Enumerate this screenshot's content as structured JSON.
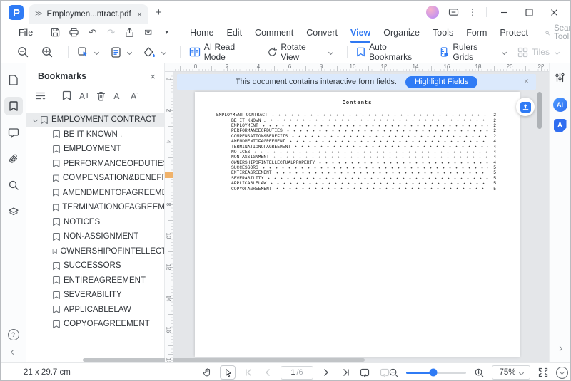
{
  "window": {
    "tab_title": "Employmen...ntract.pdf *"
  },
  "glyphs": {
    "tab_overflow": "≫",
    "kebab": "⋮",
    "plus": "+",
    "minus": "-",
    "close": "×",
    "undo": "↶",
    "redo": "↷",
    "mail": "✉",
    "dropdown_caret": "▾",
    "letter_a": "A",
    "ibeam": "I",
    "question": "?"
  },
  "menu": {
    "file": "File",
    "items": [
      {
        "label": "Home"
      },
      {
        "label": "Edit"
      },
      {
        "label": "Comment"
      },
      {
        "label": "Convert"
      },
      {
        "label": "View",
        "active": true
      },
      {
        "label": "Organize"
      },
      {
        "label": "Tools"
      },
      {
        "label": "Form"
      },
      {
        "label": "Protect"
      }
    ],
    "search_tools": "Search Tools"
  },
  "toolbar": {
    "ai_read_mode": "AI Read Mode",
    "rotate_view": "Rotate View",
    "auto_bookmarks": "Auto Bookmarks",
    "rulers_grids": "Rulers Grids",
    "tiles": "Tiles"
  },
  "bookmarks": {
    "title": "Bookmarks",
    "items": [
      {
        "label": "EMPLOYMENT CONTRACT",
        "level": 0,
        "selected": true
      },
      {
        "label": "BE IT KNOWN ,",
        "level": 1
      },
      {
        "label": "EMPLOYMENT",
        "level": 1
      },
      {
        "label": "PERFORMANCEOFDUTIES",
        "level": 1
      },
      {
        "label": "COMPENSATION&BENEFITS",
        "level": 1
      },
      {
        "label": "AMENDMENTOFAGREEMENT",
        "level": 1
      },
      {
        "label": "TERMINATIONOFAGREEMENT",
        "level": 1
      },
      {
        "label": "NOTICES",
        "level": 1
      },
      {
        "label": "NON-ASSIGNMENT",
        "level": 1
      },
      {
        "label": "OWNERSHIPOFINTELLECTUALPROPERTY",
        "level": 1
      },
      {
        "label": "SUCCESSORS",
        "level": 1
      },
      {
        "label": "ENTIREAGREEMENT",
        "level": 1
      },
      {
        "label": "SEVERABILITY",
        "level": 1
      },
      {
        "label": "APPLICABLELAW",
        "level": 1
      },
      {
        "label": "COPYOFAGREEMENT",
        "level": 1
      }
    ]
  },
  "notice": {
    "text": "This document contains interactive form fields.",
    "button": "Highlight Fields"
  },
  "document": {
    "title": "Contents",
    "toc": [
      {
        "label": "EMPLOYMENT CONTRACT",
        "page": "2",
        "indent": 0
      },
      {
        "label": "BE IT KNOWN ,",
        "page": "2",
        "indent": 1
      },
      {
        "label": "EMPLOYMENT",
        "page": "2",
        "indent": 1
      },
      {
        "label": "PERFORMANCEOFDUTIES",
        "page": "2",
        "indent": 1
      },
      {
        "label": "COMPENSATION&BENEFITS",
        "page": "2",
        "indent": 1
      },
      {
        "label": "AMENDMENTOFAGREEMENT",
        "page": "4",
        "indent": 1
      },
      {
        "label": "TERMINATIONOFAGREEMENT",
        "page": "4",
        "indent": 1
      },
      {
        "label": "NOTICES",
        "page": "4",
        "indent": 1
      },
      {
        "label": "NON-ASSIGNMENT",
        "page": "4",
        "indent": 1
      },
      {
        "label": "OWNERSHIPOFINTELLECTUALPROPERTY",
        "page": "4",
        "indent": 1
      },
      {
        "label": "SUCCESSORS",
        "page": "5",
        "indent": 1
      },
      {
        "label": "ENTIREAGREEMENT",
        "page": "5",
        "indent": 1
      },
      {
        "label": "SEVERABILITY",
        "page": "5",
        "indent": 1
      },
      {
        "label": "APPLICABLELAW",
        "page": "5",
        "indent": 1
      },
      {
        "label": "COPYOFAGREEMENT",
        "page": "5",
        "indent": 1
      }
    ],
    "ruler_h": [
      "0",
      "2",
      "4",
      "6",
      "8",
      "10",
      "12",
      "14",
      "16",
      "18",
      "20",
      "22"
    ],
    "ruler_v": [
      "0",
      "2",
      "4",
      "6",
      "8",
      "10",
      "12",
      "14",
      "16",
      "18"
    ]
  },
  "status": {
    "doc_size": "21 x 29.7 cm",
    "page_current": "1",
    "page_total": "/6",
    "zoom": "75%"
  },
  "ai": {
    "badge": "AI",
    "translate": "A"
  },
  "colors": {
    "accent": "#2F7BF5",
    "notice_bg": "#DBE9FC"
  }
}
